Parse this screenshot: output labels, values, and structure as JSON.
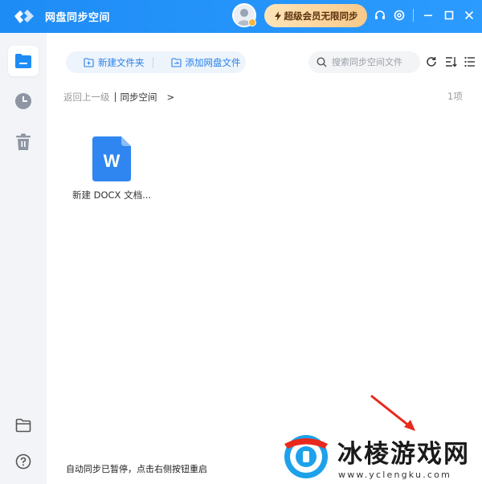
{
  "app": {
    "title": "网盘同步空间",
    "vip_label": "超级会员无限同步"
  },
  "toolbar": {
    "new_folder": "新建文件夹",
    "add_file": "添加网盘文件",
    "search_placeholder": "搜索同步空间文件"
  },
  "breadcrumb": {
    "back": "返回上一级",
    "current": "同步空间",
    "arrow": ">"
  },
  "item_count": "1项",
  "files": [
    {
      "name": "新建 DOCX 文档...",
      "type": "docx",
      "icon_letter": "W"
    }
  ],
  "status_text": "自动同步已暂停，点击右侧按钮重启",
  "watermark": {
    "title": "冰棱游戏网",
    "url": "www.yclengku.com"
  },
  "colors": {
    "titlebar": "#1e8cf5",
    "accent": "#2680eb",
    "vip_gradient_start": "#ffe4b8",
    "vip_gradient_end": "#f7c98a",
    "annotation_arrow": "#e8291c"
  }
}
